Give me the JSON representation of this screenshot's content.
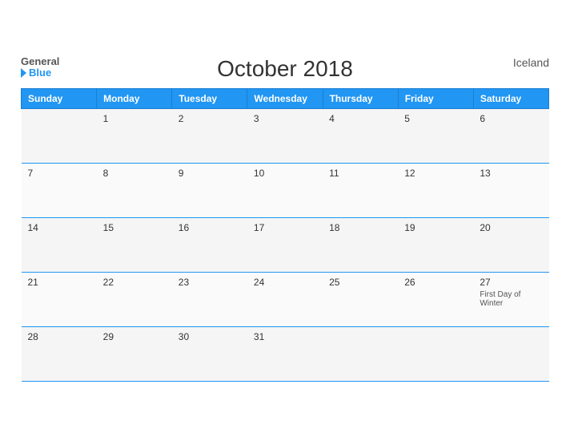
{
  "header": {
    "title": "October 2018",
    "country": "Iceland",
    "logo_general": "General",
    "logo_blue": "Blue"
  },
  "columns": [
    "Sunday",
    "Monday",
    "Tuesday",
    "Wednesday",
    "Thursday",
    "Friday",
    "Saturday"
  ],
  "weeks": [
    [
      {
        "day": "",
        "holiday": ""
      },
      {
        "day": "1",
        "holiday": ""
      },
      {
        "day": "2",
        "holiday": ""
      },
      {
        "day": "3",
        "holiday": ""
      },
      {
        "day": "4",
        "holiday": ""
      },
      {
        "day": "5",
        "holiday": ""
      },
      {
        "day": "6",
        "holiday": ""
      }
    ],
    [
      {
        "day": "7",
        "holiday": ""
      },
      {
        "day": "8",
        "holiday": ""
      },
      {
        "day": "9",
        "holiday": ""
      },
      {
        "day": "10",
        "holiday": ""
      },
      {
        "day": "11",
        "holiday": ""
      },
      {
        "day": "12",
        "holiday": ""
      },
      {
        "day": "13",
        "holiday": ""
      }
    ],
    [
      {
        "day": "14",
        "holiday": ""
      },
      {
        "day": "15",
        "holiday": ""
      },
      {
        "day": "16",
        "holiday": ""
      },
      {
        "day": "17",
        "holiday": ""
      },
      {
        "day": "18",
        "holiday": ""
      },
      {
        "day": "19",
        "holiday": ""
      },
      {
        "day": "20",
        "holiday": ""
      }
    ],
    [
      {
        "day": "21",
        "holiday": ""
      },
      {
        "day": "22",
        "holiday": ""
      },
      {
        "day": "23",
        "holiday": ""
      },
      {
        "day": "24",
        "holiday": ""
      },
      {
        "day": "25",
        "holiday": ""
      },
      {
        "day": "26",
        "holiday": ""
      },
      {
        "day": "27",
        "holiday": "First Day of Winter"
      }
    ],
    [
      {
        "day": "28",
        "holiday": ""
      },
      {
        "day": "29",
        "holiday": ""
      },
      {
        "day": "30",
        "holiday": ""
      },
      {
        "day": "31",
        "holiday": ""
      },
      {
        "day": "",
        "holiday": ""
      },
      {
        "day": "",
        "holiday": ""
      },
      {
        "day": "",
        "holiday": ""
      }
    ]
  ]
}
